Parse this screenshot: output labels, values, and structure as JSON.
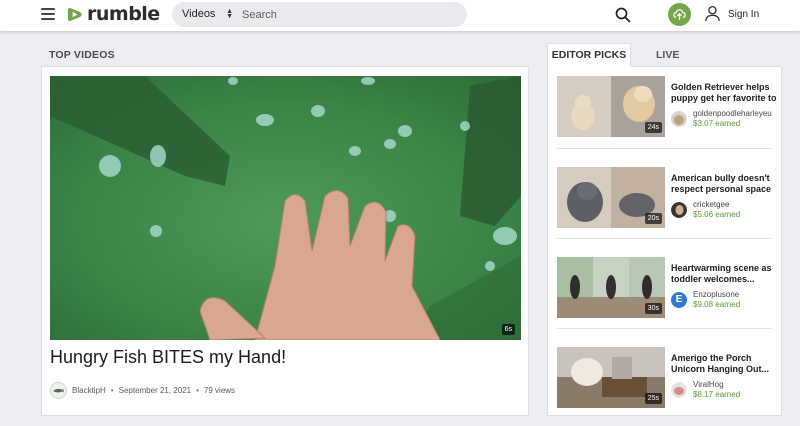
{
  "header": {
    "logo_text": "rumble",
    "search_category": "Videos",
    "search_placeholder": "Search",
    "signin_label": "Sign In",
    "brand_color": "#74a64a"
  },
  "top_videos": {
    "section_title": "TOP VIDEOS",
    "video": {
      "title": "Hungry Fish BITES my Hand!",
      "duration": "6s",
      "channel": "BlacktipH",
      "date": "September 21, 2021",
      "views": "79 views"
    }
  },
  "tabs": {
    "editor_picks": "EDITOR PICKS",
    "live": "LIVE"
  },
  "editor_picks": [
    {
      "title_line1": "Golden Retriever helps",
      "title_line2": "puppy get her favorite to",
      "duration": "24s",
      "channel": "goldenpoodleharleyeu",
      "earned": "$3.07 earned"
    },
    {
      "title_line1": "American bully doesn't",
      "title_line2": "respect personal space",
      "duration": "20s",
      "channel": "cricketgee",
      "earned": "$5.06 earned"
    },
    {
      "title_line1": "Heartwarming scene as",
      "title_line2": "toddler welcomes...",
      "duration": "30s",
      "channel": "Enzoplusone",
      "earned": "$9.08 earned",
      "avatar_letter": "E"
    },
    {
      "title_line1": "Amerigo the Porch",
      "title_line2": "Unicorn Hanging Out...",
      "duration": "25s",
      "channel": "ViralHog",
      "earned": "$8.17 earned"
    }
  ]
}
